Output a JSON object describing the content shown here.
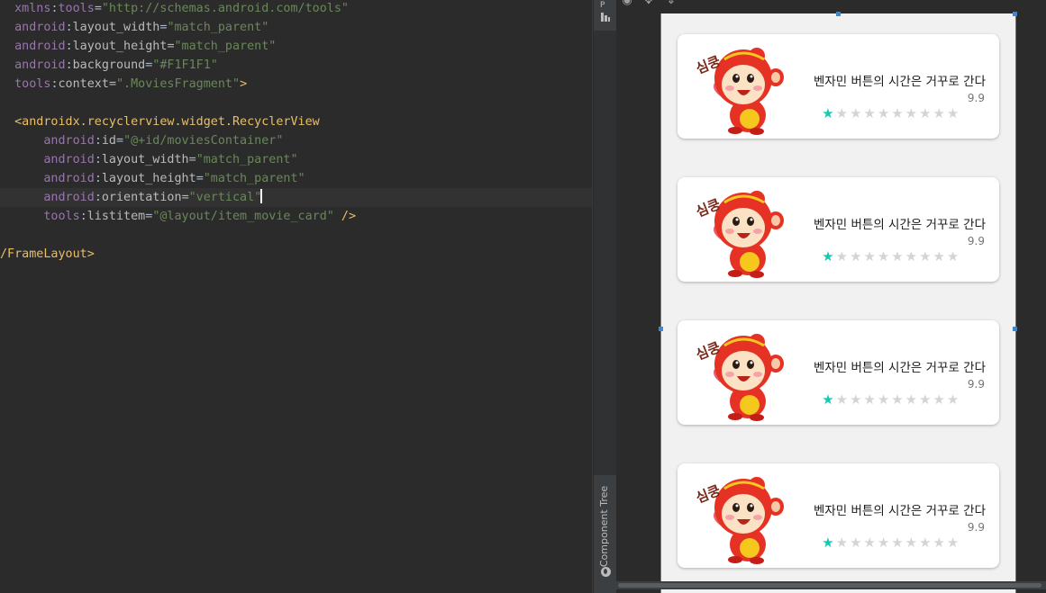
{
  "editor": {
    "lines": [
      [
        {
          "c": "t-attrns",
          "t": "  xmlns"
        },
        {
          "c": "t-plain",
          "t": ":"
        },
        {
          "c": "t-attrns",
          "t": "tools"
        },
        {
          "c": "t-plain",
          "t": "="
        },
        {
          "c": "t-str",
          "t": "\"http://schemas.android.com/tools\""
        }
      ],
      [
        {
          "c": "t-attrns",
          "t": "  android"
        },
        {
          "c": "t-plain",
          "t": ":"
        },
        {
          "c": "t-attr",
          "t": "layout_width"
        },
        {
          "c": "t-plain",
          "t": "="
        },
        {
          "c": "t-str",
          "t": "\"match_parent\""
        }
      ],
      [
        {
          "c": "t-attrns",
          "t": "  android"
        },
        {
          "c": "t-plain",
          "t": ":"
        },
        {
          "c": "t-attr",
          "t": "layout_height"
        },
        {
          "c": "t-plain",
          "t": "="
        },
        {
          "c": "t-str",
          "t": "\"match_parent\""
        }
      ],
      [
        {
          "c": "t-attrns",
          "t": "  android"
        },
        {
          "c": "t-plain",
          "t": ":"
        },
        {
          "c": "t-attr",
          "t": "background"
        },
        {
          "c": "t-plain",
          "t": "="
        },
        {
          "c": "t-str",
          "t": "\"#F1F1F1\""
        }
      ],
      [
        {
          "c": "t-attrns",
          "t": "  tools"
        },
        {
          "c": "t-plain",
          "t": ":"
        },
        {
          "c": "t-attr",
          "t": "context"
        },
        {
          "c": "t-plain",
          "t": "="
        },
        {
          "c": "t-str",
          "t": "\".MoviesFragment\""
        },
        {
          "c": "t-tag",
          "t": ">"
        }
      ],
      [],
      [
        {
          "c": "t-tag",
          "t": "  <androidx.recyclerview.widget.RecyclerView"
        }
      ],
      [
        {
          "c": "t-attrns",
          "t": "      android"
        },
        {
          "c": "t-plain",
          "t": ":"
        },
        {
          "c": "t-attr",
          "t": "id"
        },
        {
          "c": "t-plain",
          "t": "="
        },
        {
          "c": "t-str",
          "t": "\"@+id/moviesContainer\""
        }
      ],
      [
        {
          "c": "t-attrns",
          "t": "      android"
        },
        {
          "c": "t-plain",
          "t": ":"
        },
        {
          "c": "t-attr",
          "t": "layout_width"
        },
        {
          "c": "t-plain",
          "t": "="
        },
        {
          "c": "t-str",
          "t": "\"match_parent\""
        }
      ],
      [
        {
          "c": "t-attrns",
          "t": "      android"
        },
        {
          "c": "t-plain",
          "t": ":"
        },
        {
          "c": "t-attr",
          "t": "layout_height"
        },
        {
          "c": "t-plain",
          "t": "="
        },
        {
          "c": "t-str",
          "t": "\"match_parent\""
        }
      ],
      [
        {
          "c": "t-attrns",
          "t": "      android"
        },
        {
          "c": "t-plain",
          "t": ":"
        },
        {
          "c": "t-attr",
          "t": "orientation"
        },
        {
          "c": "t-plain",
          "t": "="
        },
        {
          "c": "t-str",
          "t": "\"vertical\"",
          "caret": true
        }
      ],
      [
        {
          "c": "t-attrns",
          "t": "      tools"
        },
        {
          "c": "t-plain",
          "t": ":"
        },
        {
          "c": "t-attr",
          "t": "listitem"
        },
        {
          "c": "t-plain",
          "t": "="
        },
        {
          "c": "t-str",
          "t": "\"@layout/item_movie_card\""
        },
        {
          "c": "t-tag",
          "t": " />"
        }
      ],
      [],
      [
        {
          "c": "t-tag",
          "t": "/FrameLayout>"
        }
      ]
    ],
    "current_line_index": 10
  },
  "side_panel": {
    "palette_glyph": "P",
    "component_tree_label": "Component Tree"
  },
  "toolbar_icons": [
    "eye-icon",
    "pan-icon",
    "vertical-resize-icon"
  ],
  "movie_cards": [
    {
      "title": "벤자민 버튼의 시간은 거꾸로 간다",
      "score": "9.9",
      "rating": 1,
      "max_rating": 10
    },
    {
      "title": "벤자민 버튼의 시간은 거꾸로 간다",
      "score": "9.9",
      "rating": 1,
      "max_rating": 10
    },
    {
      "title": "벤자민 버튼의 시간은 거꾸로 간다",
      "score": "9.9",
      "rating": 1,
      "max_rating": 10
    },
    {
      "title": "벤자민 버튼의 시간은 거꾸로 간다",
      "score": "9.9",
      "rating": 1,
      "max_rating": 10
    }
  ],
  "poster_text": "심쿵",
  "colors": {
    "editor_bg": "#2b2b2b",
    "phone_bg": "#F1F1F1",
    "star_filled": "#17c9b3",
    "star_empty": "#d4d4d4",
    "selection_blue": "#3d86d6"
  }
}
